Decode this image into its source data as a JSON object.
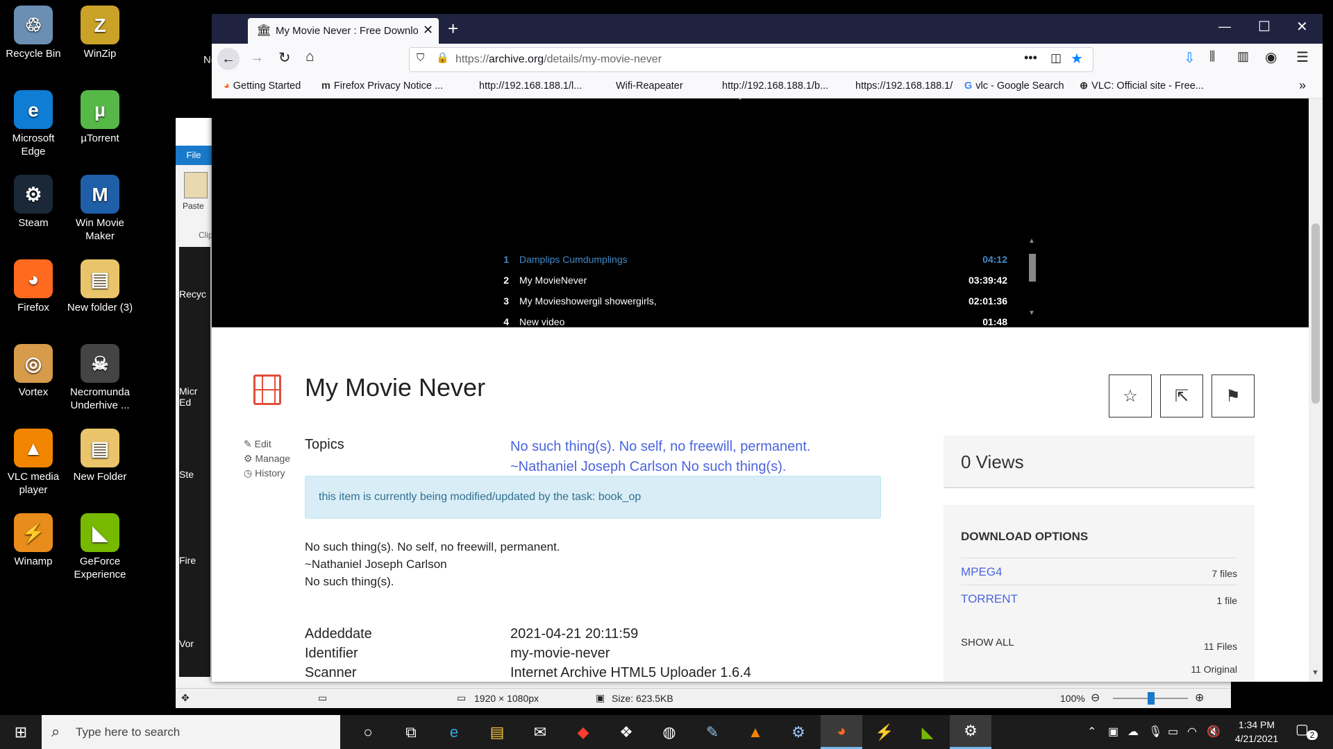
{
  "desktop": {
    "icons": [
      {
        "label": "Recycle Bin",
        "glyph": "♲",
        "color": "#6b8fb3"
      },
      {
        "label": "WinZip",
        "glyph": "Z",
        "color": "#c9a227"
      },
      {
        "label": "Microsoft Edge",
        "glyph": "e",
        "color": "#0f7dd4"
      },
      {
        "label": "µTorrent",
        "glyph": "µ",
        "color": "#56b947"
      },
      {
        "label": "Steam",
        "glyph": "⚙",
        "color": "#1b2838"
      },
      {
        "label": "Win Movie Maker",
        "glyph": "M",
        "color": "#1f5fa8"
      },
      {
        "label": "Firefox",
        "glyph": "◕",
        "color": "#ff6a1f"
      },
      {
        "label": "New folder (3)",
        "glyph": "▤",
        "color": "#e9c46a"
      },
      {
        "label": "Vortex",
        "glyph": "◎",
        "color": "#d79b4c"
      },
      {
        "label": "Necromunda Underhive ...",
        "glyph": "☠",
        "color": "#444"
      },
      {
        "label": "VLC media player",
        "glyph": "▲",
        "color": "#f28500"
      },
      {
        "label": "New Folder",
        "glyph": "▤",
        "color": "#e9c46a"
      },
      {
        "label": "Winamp",
        "glyph": "⚡",
        "color": "#e88c1c"
      },
      {
        "label": "GeForce Experience",
        "glyph": "◣",
        "color": "#76b900"
      }
    ]
  },
  "paint": {
    "file_tab": "File",
    "paste_label": "Paste",
    "clip_label": "Clip",
    "ne_label": "Ne",
    "side_labels": [
      "Recyc",
      "Micr Ed",
      "Ste",
      "Fire",
      "Vor"
    ],
    "status_dims": "1920 × 1080px",
    "status_size": "Size: 623.5KB",
    "zoom": "100%"
  },
  "browser": {
    "tab_title": "My Movie Never : Free Downlo",
    "url_prefix": "https://",
    "url_host": "archive.org",
    "url_path": "/details/my-movie-never",
    "bookmarks": [
      {
        "label": "Getting Started",
        "icon": "firefox-icon"
      },
      {
        "label": "Firefox Privacy Notice ...",
        "icon": "m-icon"
      },
      {
        "label": "http://192.168.188.1/l...",
        "icon": ""
      },
      {
        "label": "Wifi-Reapeater",
        "icon": ""
      },
      {
        "label": "http://192.168.188.1/b...",
        "icon": ""
      },
      {
        "label": "https://192.168.188.1/",
        "icon": ""
      },
      {
        "label": "vlc - Google Search",
        "icon": "google-icon"
      },
      {
        "label": "VLC: Official site - Free...",
        "icon": "globe-icon"
      }
    ]
  },
  "playlist": [
    {
      "n": "1",
      "title": "Damplips Cumdumplings",
      "dur": "04:12",
      "active": true
    },
    {
      "n": "2",
      "title": "My MovieNever",
      "dur": "03:39:42",
      "active": false
    },
    {
      "n": "3",
      "title": "My Movieshowergil showergirls,",
      "dur": "02:01:36",
      "active": false
    },
    {
      "n": "4",
      "title": "New video",
      "dur": "01:48",
      "active": false
    }
  ],
  "item": {
    "title": "My Movie Never",
    "edit": "Edit",
    "manage": "Manage",
    "history": "History",
    "topics_label": "Topics",
    "topics_line1_a": "No such thing(s). No self",
    "topics_line1_b": ", ",
    "topics_line1_c": "no freewill",
    "topics_line1_d": ", ",
    "topics_line1_e": "permanent.",
    "topics_line2": "~Nathaniel Joseph Carlson No such thing(s).",
    "notice": "this item is currently being modified/updated by the task: book_op",
    "description": [
      "No such thing(s). No self, no freewill, permanent.",
      "~Nathaniel Joseph Carlson",
      "No such thing(s)."
    ],
    "metadata": [
      {
        "k": "Addeddate",
        "v": "2021-04-21 20:11:59"
      },
      {
        "k": "Identifier",
        "v": "my-movie-never"
      },
      {
        "k": "Scanner",
        "v": "Internet Archive HTML5 Uploader 1.6.4"
      }
    ],
    "views": "0 Views",
    "download_heading": "DOWNLOAD OPTIONS",
    "downloads": [
      {
        "name": "MPEG4",
        "count": "7 files"
      },
      {
        "name": "TORRENT",
        "count": "1 file"
      }
    ],
    "show_all": "SHOW ALL",
    "files_total": "11 Files",
    "files_original": "11 Original"
  },
  "taskbar": {
    "search_placeholder": "Type here to search",
    "time": "1:34 PM",
    "date": "4/21/2021",
    "notification_count": "2"
  }
}
